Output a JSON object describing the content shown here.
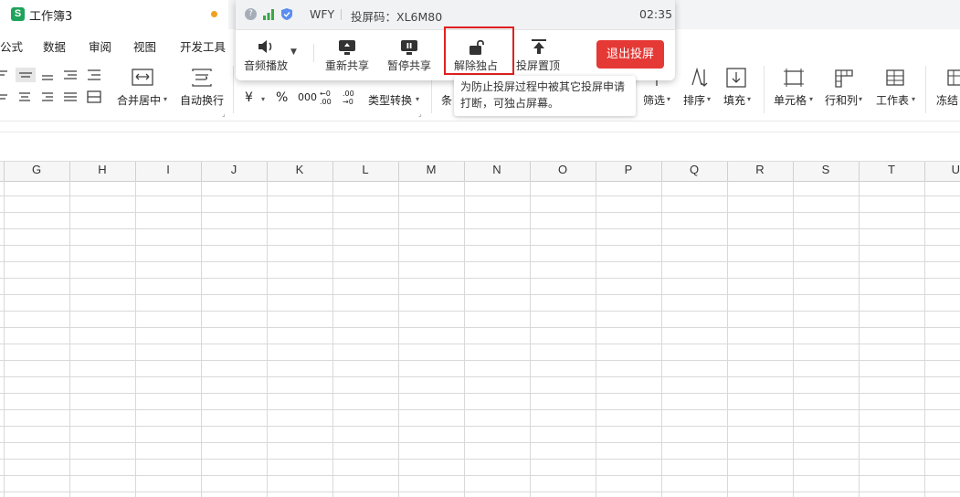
{
  "window": {
    "doc_title": "工作簿3"
  },
  "menu": [
    "公式",
    "数据",
    "审阅",
    "视图",
    "开发工具"
  ],
  "ribbon": {
    "merge_center": "合并居中",
    "wrap_text": "自动换行",
    "currency": "¥",
    "percent": "%",
    "thousands": "000",
    "dec_increase": "←0 .00",
    "dec_decrease": ".00 →0",
    "type_convert": "类型转换",
    "conditional_partial": "条",
    "filter": "筛选",
    "sort": "排序",
    "fill": "填充",
    "cell": "单元格",
    "row_col": "行和列",
    "worksheet": "工作表",
    "freeze": "冻结"
  },
  "columns": [
    "G",
    "H",
    "I",
    "J",
    "K",
    "L",
    "M",
    "N",
    "O",
    "P",
    "Q",
    "R",
    "S",
    "T",
    "U"
  ],
  "share_panel": {
    "name": "WFY",
    "code": "投屏码：XL6M80",
    "time": "02:35",
    "audio": "音频播放",
    "reshare": "重新共享",
    "pause": "暂停共享",
    "unlock": "解除独占",
    "pin_top": "投屏置顶",
    "exit": "退出投屏",
    "tooltip_line1": "为防止投屏过程中被其它投屏申请",
    "tooltip_line2": "打断，可独占屏幕。"
  },
  "colors": {
    "accent_red": "#e53935",
    "app_green": "#1fa35b",
    "highlight": "#e02020"
  }
}
